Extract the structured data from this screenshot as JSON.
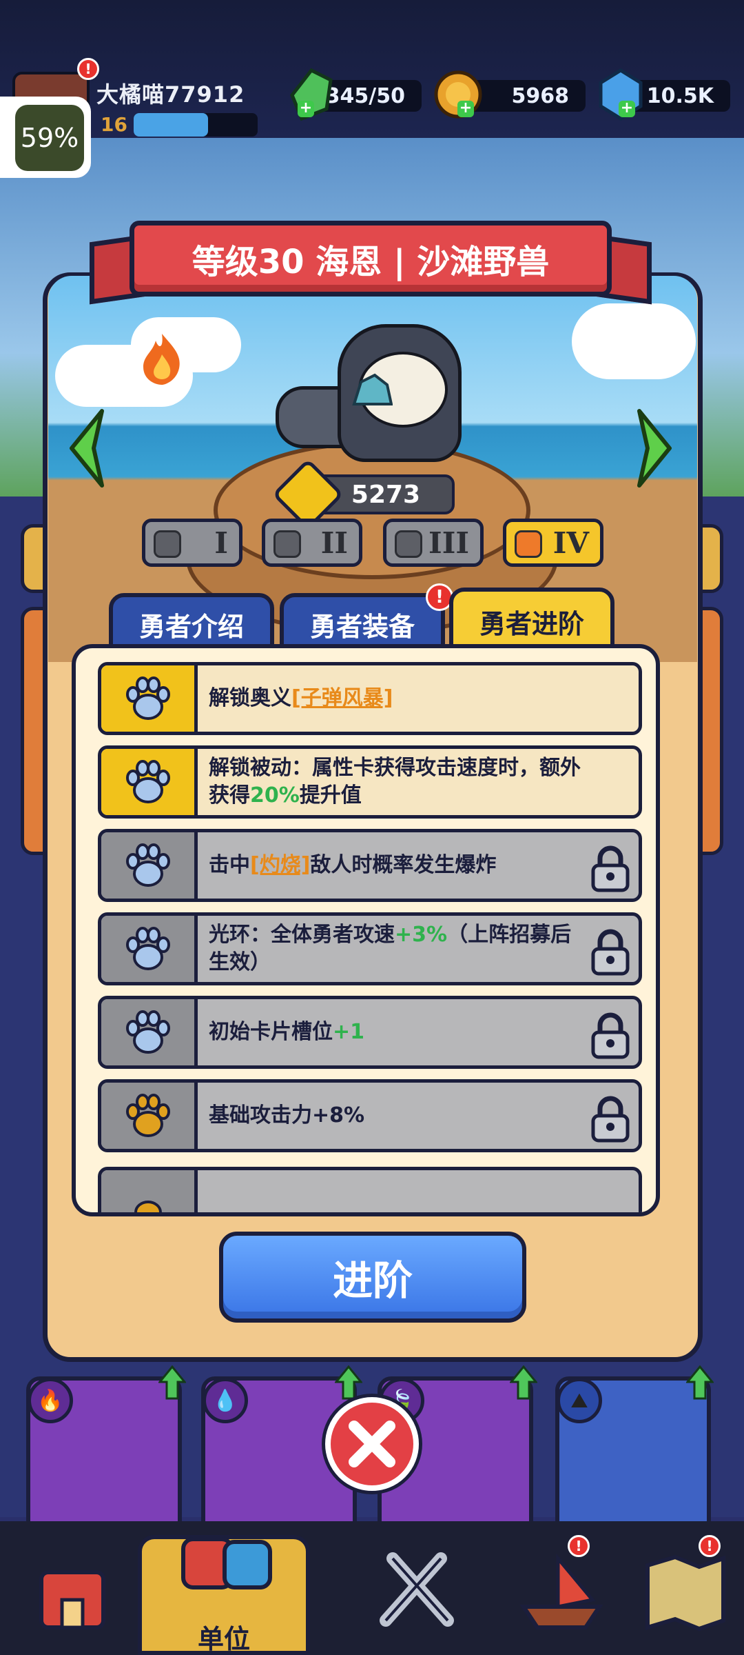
{
  "status": {
    "progress_text": "59%"
  },
  "player": {
    "name": "大橘喵77912",
    "level": "16",
    "xp_fraction": 0.6
  },
  "resources": [
    {
      "icon": "stamina-icon",
      "value": "345/50"
    },
    {
      "icon": "coin-icon",
      "value": "5968"
    },
    {
      "icon": "gem-icon",
      "value": "10.5K"
    }
  ],
  "hero": {
    "title": "等级30 海恩 | 沙滩野兽",
    "power": "5273",
    "ranks": [
      "I",
      "II",
      "III",
      "IV"
    ],
    "active_rank": "IV"
  },
  "tabs": [
    {
      "label": "勇者介绍"
    },
    {
      "label": "勇者装备"
    },
    {
      "label": "勇者进阶"
    }
  ],
  "advancements": [
    {
      "parts": [
        "解锁奥义",
        "[子弹风暴]",
        ""
      ],
      "status": "unlocked"
    },
    {
      "parts": [
        "解锁被动：属性卡获得攻击速度时，额外获得",
        "20%",
        "提升值"
      ],
      "status": "unlocked"
    },
    {
      "parts": [
        "击中",
        "[灼烧]",
        "敌人时概率发生爆炸"
      ],
      "status": "locked"
    },
    {
      "parts": [
        "光环：全体勇者攻速",
        "+3%",
        "（上阵招募后生效）"
      ],
      "status": "locked"
    },
    {
      "parts": [
        "初始卡片槽位",
        "+1",
        ""
      ],
      "status": "locked"
    },
    {
      "parts": [
        "基础攻击力+8%",
        "",
        ""
      ],
      "status": "locked"
    }
  ],
  "actions": {
    "advance_label": "进阶"
  },
  "nav": {
    "active_label": "单位"
  },
  "colors": {
    "accent_yellow": "#f6cd35",
    "banner_red": "#e2494c",
    "button_blue": "#3a75e6"
  }
}
